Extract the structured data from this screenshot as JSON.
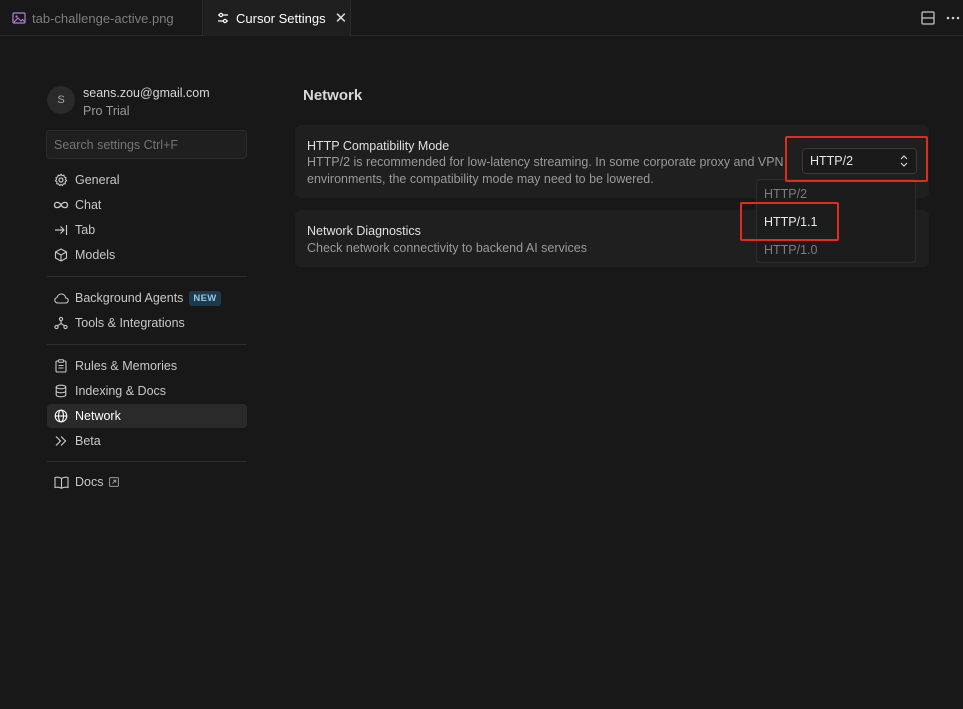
{
  "tabs": {
    "inactive_label": "tab-challenge-active.png",
    "active_label": "Cursor Settings",
    "close_glyph": "✕"
  },
  "account": {
    "avatar_letter": "S",
    "email": "seans.zou@gmail.com",
    "plan": "Pro Trial"
  },
  "search": {
    "placeholder": "Search settings Ctrl+F"
  },
  "sidebar": {
    "items": [
      {
        "label": "General",
        "icon": "gear-icon"
      },
      {
        "label": "Chat",
        "icon": "infinity-icon"
      },
      {
        "label": "Tab",
        "icon": "tab-arrow-icon"
      },
      {
        "label": "Models",
        "icon": "cube-icon"
      },
      {
        "label": "Background Agents",
        "icon": "cloud-icon",
        "badge": "NEW"
      },
      {
        "label": "Tools & Integrations",
        "icon": "tools-icon"
      },
      {
        "label": "Rules & Memories",
        "icon": "clipboard-icon"
      },
      {
        "label": "Indexing & Docs",
        "icon": "database-icon"
      },
      {
        "label": "Network",
        "icon": "globe-icon",
        "active": true
      },
      {
        "label": "Beta",
        "icon": "double-chevron-icon"
      },
      {
        "label": "Docs",
        "icon": "book-icon"
      }
    ]
  },
  "main": {
    "title": "Network",
    "http_card": {
      "title": "HTTP Compatibility Mode",
      "desc_line1": "HTTP/2 is recommended for low-latency streaming. In some corporate proxy and VPN",
      "desc_line2": "environments, the compatibility mode may need to be lowered.",
      "selected": "HTTP/2",
      "options": [
        "HTTP/2",
        "HTTP/1.1",
        "HTTP/1.0"
      ]
    },
    "diag_card": {
      "title": "Network Diagnostics",
      "desc": "Check network connectivity to backend AI services"
    }
  },
  "colors": {
    "background": "#181818",
    "card": "#1f1f1f",
    "highlight_box": "#e12b1d",
    "new_badge": "#1e3a4a"
  }
}
